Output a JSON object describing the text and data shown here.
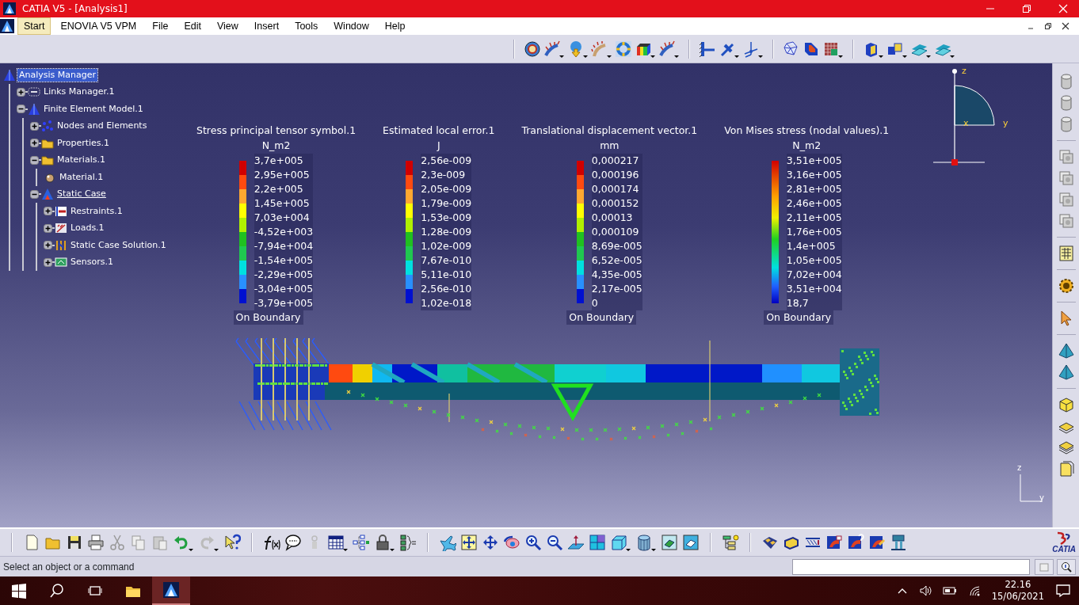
{
  "window": {
    "title": "CATIA V5 - [Analysis1]"
  },
  "menu": [
    {
      "label": "Start",
      "selected": true
    },
    {
      "label": "ENOVIA V5 VPM",
      "selected": false
    },
    {
      "label": "File",
      "selected": false
    },
    {
      "label": "Edit",
      "selected": false
    },
    {
      "label": "View",
      "selected": false
    },
    {
      "label": "Insert",
      "selected": false
    },
    {
      "label": "Tools",
      "selected": false
    },
    {
      "label": "Window",
      "selected": false
    },
    {
      "label": "Help",
      "selected": false
    }
  ],
  "tree": {
    "label": "Analysis Manager",
    "kind": "analysis",
    "selected": true,
    "current": false,
    "children": [
      {
        "label": "Links Manager.1",
        "kind": "links",
        "selected": false,
        "current": false,
        "expanded": false
      },
      {
        "label": "Finite Element Model.1",
        "kind": "model",
        "selected": false,
        "current": false,
        "expanded": true,
        "children": [
          {
            "label": "Nodes and Elements",
            "kind": "nodes",
            "selected": false,
            "current": false,
            "expanded": false
          },
          {
            "label": "Properties.1",
            "kind": "folder",
            "selected": false,
            "current": false,
            "expanded": false
          },
          {
            "label": "Materials.1",
            "kind": "folder",
            "selected": false,
            "current": false,
            "expanded": true,
            "children": [
              {
                "label": "Material.1",
                "kind": "material",
                "selected": false,
                "current": false
              }
            ]
          },
          {
            "label": "Static Case",
            "kind": "case",
            "selected": false,
            "current": true,
            "expanded": true,
            "children": [
              {
                "label": "Restraints.1",
                "kind": "restraints",
                "selected": false,
                "current": false,
                "expanded": false
              },
              {
                "label": "Loads.1",
                "kind": "loads",
                "selected": false,
                "current": false,
                "expanded": false
              },
              {
                "label": "Static Case Solution.1",
                "kind": "solution",
                "selected": false,
                "current": false,
                "expanded": false
              },
              {
                "label": "Sensors.1",
                "kind": "sensors",
                "selected": false,
                "current": false,
                "expanded": false
              }
            ]
          }
        ]
      }
    ]
  },
  "legends": [
    {
      "title": "Stress principal tensor symbol.1",
      "unit": "N_m2",
      "kind": "discrete",
      "values": [
        "3,7e+005",
        "2,95e+005",
        "2,2e+005",
        "1,45e+005",
        "7,03e+004",
        "-4,52e+003",
        "-7,94e+004",
        "-1,54e+005",
        "-2,29e+005",
        "-3,04e+005",
        "-3,79e+005"
      ],
      "footer": "On Boundary"
    },
    {
      "title": "Estimated local error.1",
      "unit": "J",
      "kind": "discrete",
      "values": [
        "2,56e-009",
        "2,3e-009",
        "2,05e-009",
        "1,79e-009",
        "1,53e-009",
        "1,28e-009",
        "1,02e-009",
        "7,67e-010",
        "5,11e-010",
        "2,56e-010",
        "1,02e-018"
      ]
    },
    {
      "title": "Translational displacement vector.1",
      "unit": "mm",
      "kind": "discrete",
      "values": [
        "0,000217",
        "0,000196",
        "0,000174",
        "0,000152",
        "0,00013",
        "0,000109",
        "8,69e-005",
        "6,52e-005",
        "4,35e-005",
        "2,17e-005",
        "0"
      ],
      "footer": "On Boundary"
    },
    {
      "title": "Von Mises stress (nodal values).1",
      "unit": "N_m2",
      "kind": "smooth",
      "values": [
        "3,51e+005",
        "3,16e+005",
        "2,81e+005",
        "2,46e+005",
        "2,11e+005",
        "1,76e+005",
        "1,4e+005",
        "1,05e+005",
        "7,02e+004",
        "3,51e+004",
        "18,7"
      ],
      "footer": "On Boundary"
    }
  ],
  "compass": {
    "z_label": "z",
    "y_label": "y",
    "x_label": "x"
  },
  "axis_indicator": {
    "z_label": "z",
    "y_label": "y"
  },
  "logo": {
    "text": "CATIA"
  },
  "status_bar": {
    "message": "Select an object or a command"
  },
  "taskbar": {
    "time": "22.16",
    "date": "15/06/2021"
  }
}
